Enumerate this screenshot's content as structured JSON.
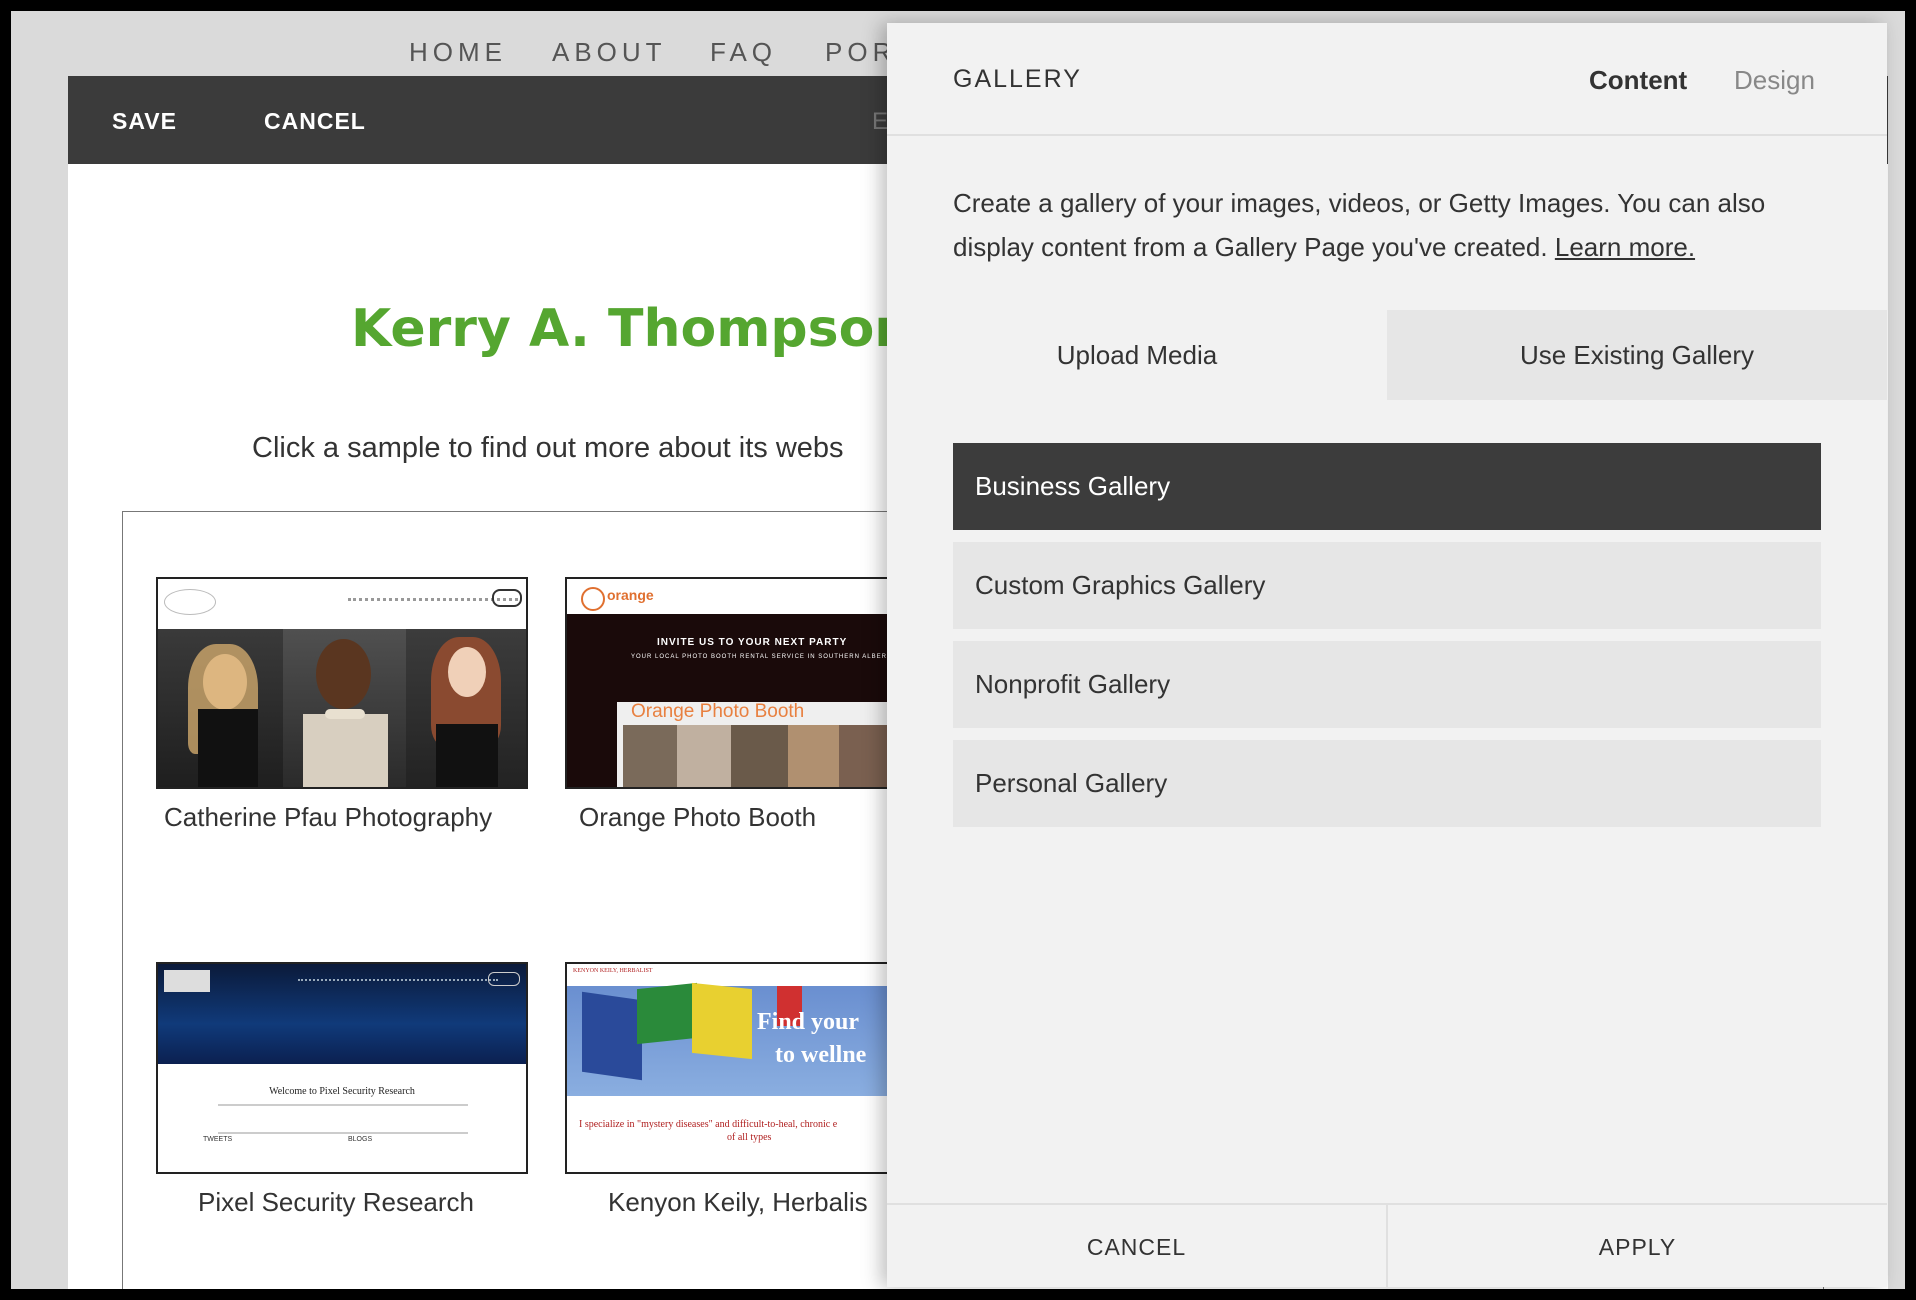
{
  "site_nav": [
    "HOME",
    "ABOUT",
    "FAQ",
    "POR"
  ],
  "editor_bar": {
    "save": "SAVE",
    "cancel": "CANCEL",
    "status": "Editi"
  },
  "page": {
    "title": "Kerry A. Thompson Po",
    "subtitle": "Click a sample to find out more about its webs"
  },
  "samples": [
    {
      "caption": "Catherine Pfau Photography"
    },
    {
      "caption": "Orange Photo Booth",
      "logo": "orange",
      "headline1": "INVITE US TO YOUR NEXT PARTY",
      "headline2": "YOUR LOCAL PHOTO BOOTH RENTAL SERVICE IN SOUTHERN ALBERTA",
      "sign": "Orange Photo Booth"
    },
    {
      "caption": "Pixel Security Research",
      "heading": "Welcome to Pixel Security Research",
      "col1": "TWEETS",
      "col2": "BLOGS"
    },
    {
      "caption": "Kenyon Keily, Herbalis",
      "name": "KENYON KEILY, HERBALIST",
      "headline": "Find your",
      "headline2": "to wellne",
      "sub": "I specialize in \"mystery diseases\" and difficult-to-heal, chronic e",
      "sub2": "of all types"
    }
  ],
  "panel": {
    "title": "GALLERY",
    "tabs": {
      "content": "Content",
      "design": "Design"
    },
    "description": "Create a gallery of your images, videos, or Getty Images. You can also display content from a Gallery Page you've created.",
    "learn_more": "Learn more.",
    "segments": {
      "upload": "Upload Media",
      "existing": "Use Existing Gallery"
    },
    "galleries": [
      "Business Gallery",
      "Custom Graphics Gallery",
      "Nonprofit Gallery",
      "Personal Gallery"
    ],
    "selected_gallery": "Business Gallery",
    "footer": {
      "cancel": "CANCEL",
      "apply": "APPLY"
    }
  },
  "colors": {
    "accent_green": "#55a630",
    "selected_dark": "#3c3c3c",
    "item_bg": "#e6e6e6"
  }
}
